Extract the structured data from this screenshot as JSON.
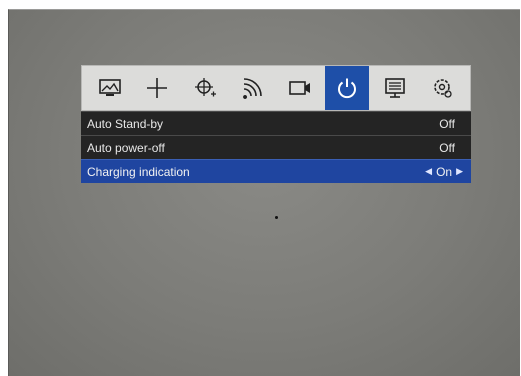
{
  "menu": {
    "tabs": [
      {
        "name": "picture-icon",
        "active": false
      },
      {
        "name": "crosshair-icon",
        "active": false
      },
      {
        "name": "reticle-icon",
        "active": false
      },
      {
        "name": "wireless-icon",
        "active": false
      },
      {
        "name": "video-camera-icon",
        "active": false
      },
      {
        "name": "power-icon",
        "active": true
      },
      {
        "name": "display-settings-icon",
        "active": false
      },
      {
        "name": "system-settings-icon",
        "active": false
      }
    ],
    "rows": [
      {
        "label": "Auto Stand-by",
        "value": "Off"
      },
      {
        "label": "Auto power-off",
        "value": "Off"
      },
      {
        "label": "Charging indication",
        "value": "On",
        "selected": true
      }
    ]
  },
  "colors": {
    "accent": "#1e4fa8",
    "row_bg": "#242424",
    "iconbar_bg": "#dcdcda"
  }
}
